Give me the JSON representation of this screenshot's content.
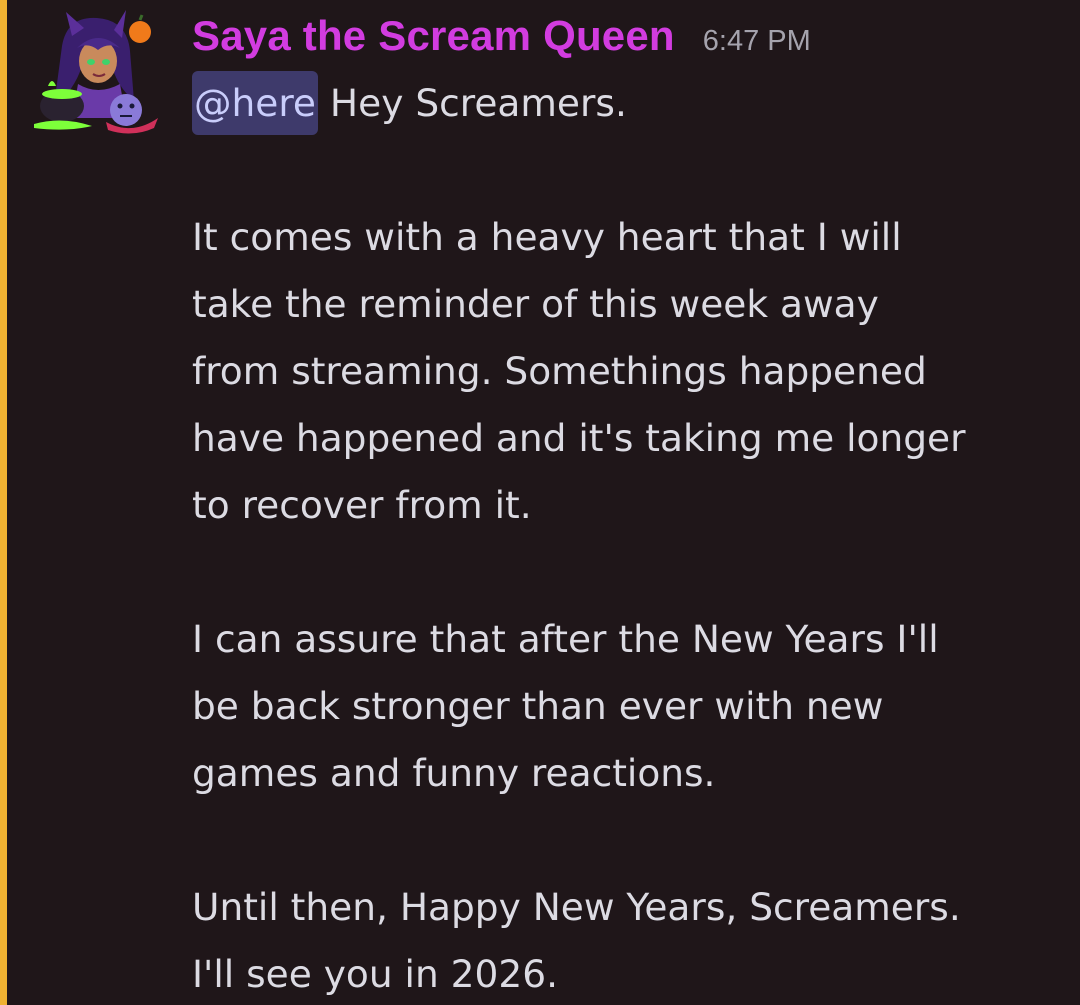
{
  "message": {
    "author": "Saya the Scream Queen",
    "timestamp": "6:47 PM",
    "mention": "@here",
    "first_line_text": " Hey Screamers.",
    "paragraph_1": [
      "It comes with a heavy heart that I will",
      "take the reminder of this week away",
      "from streaming. Somethings happened",
      "have happened and it's taking me longer",
      "to recover from it."
    ],
    "paragraph_2": [
      "I can assure that after the New Years I'll",
      "be back stronger than ever with new",
      "games and funny reactions."
    ],
    "paragraph_3": [
      "Until then, Happy New Years, Screamers.",
      "I'll see you in 2026."
    ]
  },
  "colors": {
    "background": "#1f1619",
    "author": "#d23ce0",
    "mention_bg": "#3e3a6b",
    "mention_text": "#c9cdfb",
    "highlight_bar": "#f0b232"
  },
  "icons": {
    "avatar": "avatar-icon"
  }
}
